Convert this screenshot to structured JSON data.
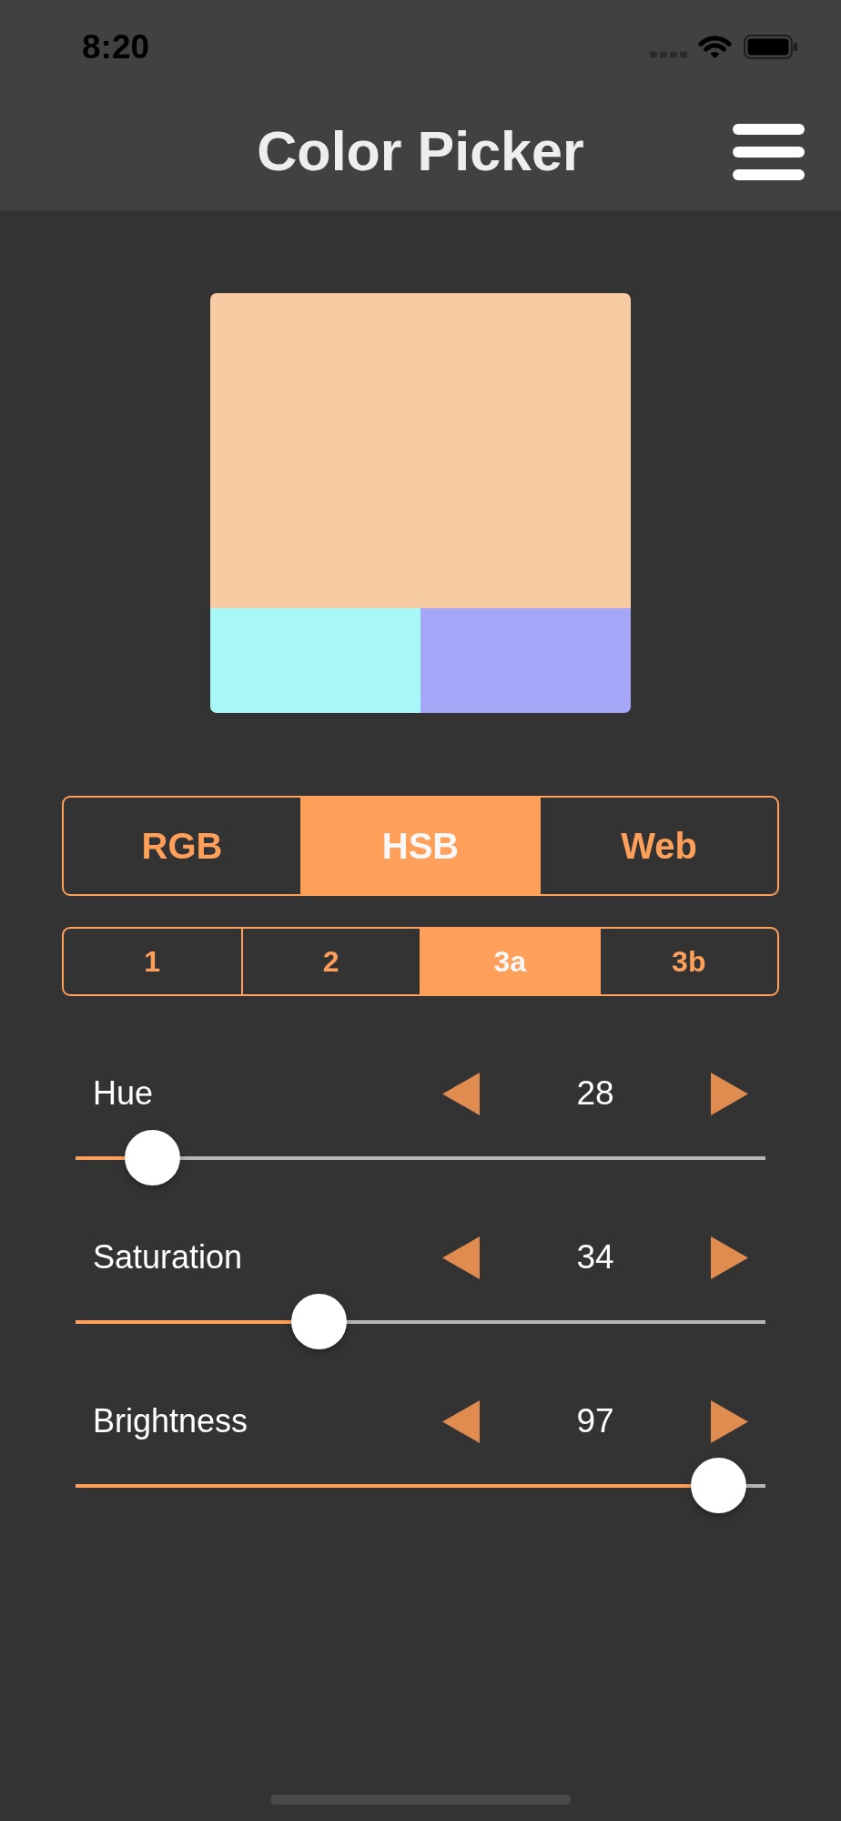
{
  "status_bar": {
    "time": "8:20"
  },
  "nav_bar": {
    "title": "Color Picker"
  },
  "preview": {
    "swatches": [
      {
        "kind": "main",
        "color": "#f8cca2"
      },
      {
        "kind": "variant",
        "color": "#a7f8f6"
      },
      {
        "kind": "variant",
        "color": "#a6a6f9"
      }
    ]
  },
  "mode_tabs": [
    {
      "label": "RGB",
      "selected": false
    },
    {
      "label": "HSB",
      "selected": true
    },
    {
      "label": "Web",
      "selected": false
    }
  ],
  "scheme_tabs": [
    {
      "label": "1",
      "selected": false
    },
    {
      "label": "2",
      "selected": false
    },
    {
      "label": "3a",
      "selected": true
    },
    {
      "label": "3b",
      "selected": false
    }
  ],
  "sliders": [
    {
      "label": "Hue",
      "value": "28",
      "level": 0.078
    },
    {
      "label": "Saturation",
      "value": "34",
      "level": 0.34
    },
    {
      "label": "Brightness",
      "value": "97",
      "level": 0.97
    }
  ]
}
